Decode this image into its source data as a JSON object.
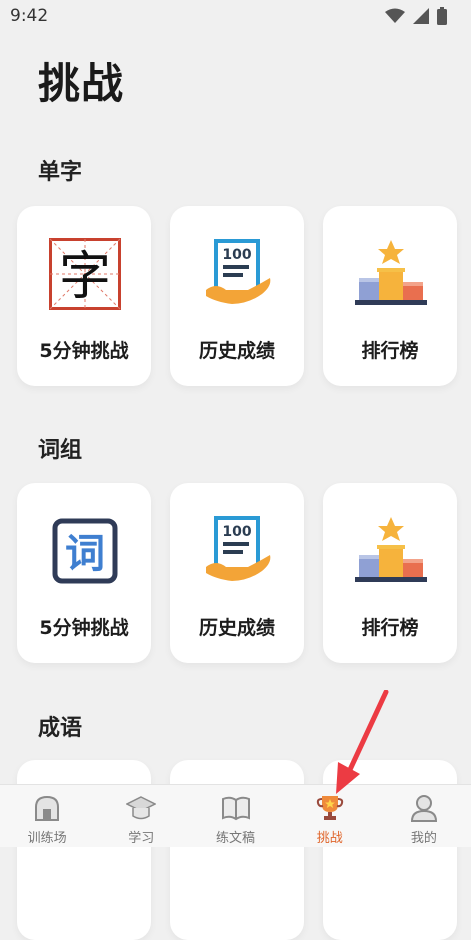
{
  "status_bar": {
    "time": "9:42"
  },
  "page_title": "挑战",
  "sections": [
    {
      "title": "单字",
      "cards": [
        {
          "label": "5分钟挑战",
          "icon": "zi-grid-icon"
        },
        {
          "label": "历史成绩",
          "icon": "score-hand-icon"
        },
        {
          "label": "排行榜",
          "icon": "podium-star-icon"
        }
      ]
    },
    {
      "title": "词组",
      "cards": [
        {
          "label": "5分钟挑战",
          "icon": "ci-box-icon"
        },
        {
          "label": "历史成绩",
          "icon": "score-hand-icon"
        },
        {
          "label": "排行榜",
          "icon": "podium-star-icon"
        }
      ]
    },
    {
      "title": "成语"
    }
  ],
  "icon_glyphs": {
    "zi": "字",
    "ci": "词",
    "score": "100"
  },
  "tabs": [
    {
      "label": "训练场",
      "icon": "house-icon"
    },
    {
      "label": "学习",
      "icon": "graduation-cap-icon"
    },
    {
      "label": "练文稿",
      "icon": "book-icon"
    },
    {
      "label": "挑战",
      "icon": "trophy-icon",
      "active": true
    },
    {
      "label": "我的",
      "icon": "user-icon"
    }
  ],
  "colors": {
    "accent": "#e0662c",
    "arrow": "#ec3b43"
  }
}
